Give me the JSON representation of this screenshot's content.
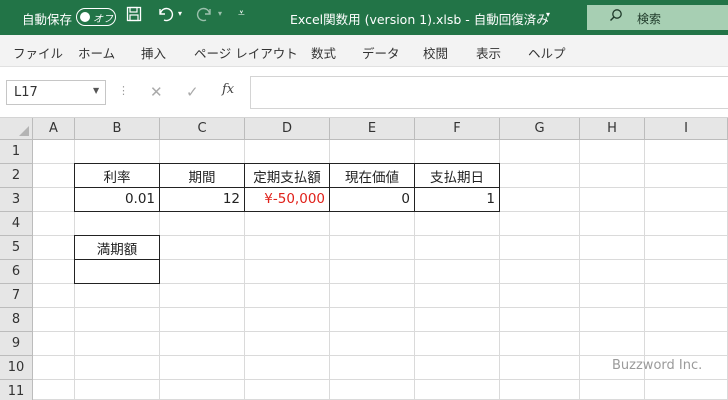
{
  "titlebar": {
    "autosave_label": "自動保存",
    "autosave_state": "オフ",
    "title": "Excel関数用 (version 1).xlsb  -  自動回復済み",
    "search_label": "検索"
  },
  "ribbon": {
    "tabs": [
      "ファイル",
      "ホーム",
      "挿入",
      "ページ レイアウト",
      "数式",
      "データ",
      "校閲",
      "表示",
      "ヘルプ"
    ]
  },
  "formula_bar": {
    "name_box": "L17",
    "fx_label": "fx",
    "formula": ""
  },
  "sheet": {
    "columns": [
      "A",
      "B",
      "C",
      "D",
      "E",
      "F",
      "G",
      "H",
      "I"
    ],
    "rows": [
      "1",
      "2",
      "3",
      "4",
      "5",
      "6",
      "7",
      "8",
      "9",
      "10",
      "11"
    ],
    "cells": {
      "B2": "利率",
      "C2": "期間",
      "D2": "定期支払額",
      "E2": "現在価値",
      "F2": "支払期日",
      "B3": "0.01",
      "C3": "12",
      "D3": "¥-50,000",
      "E3": "0",
      "F3": "1",
      "B5": "満期額",
      "B6": ""
    },
    "negative_color": "#e0211a"
  },
  "watermark": "Buzzword Inc.",
  "colors": {
    "titlebar_bg": "#227447",
    "ribbon_bg": "#f3f3f3",
    "header_bg": "#e6e6e6"
  }
}
